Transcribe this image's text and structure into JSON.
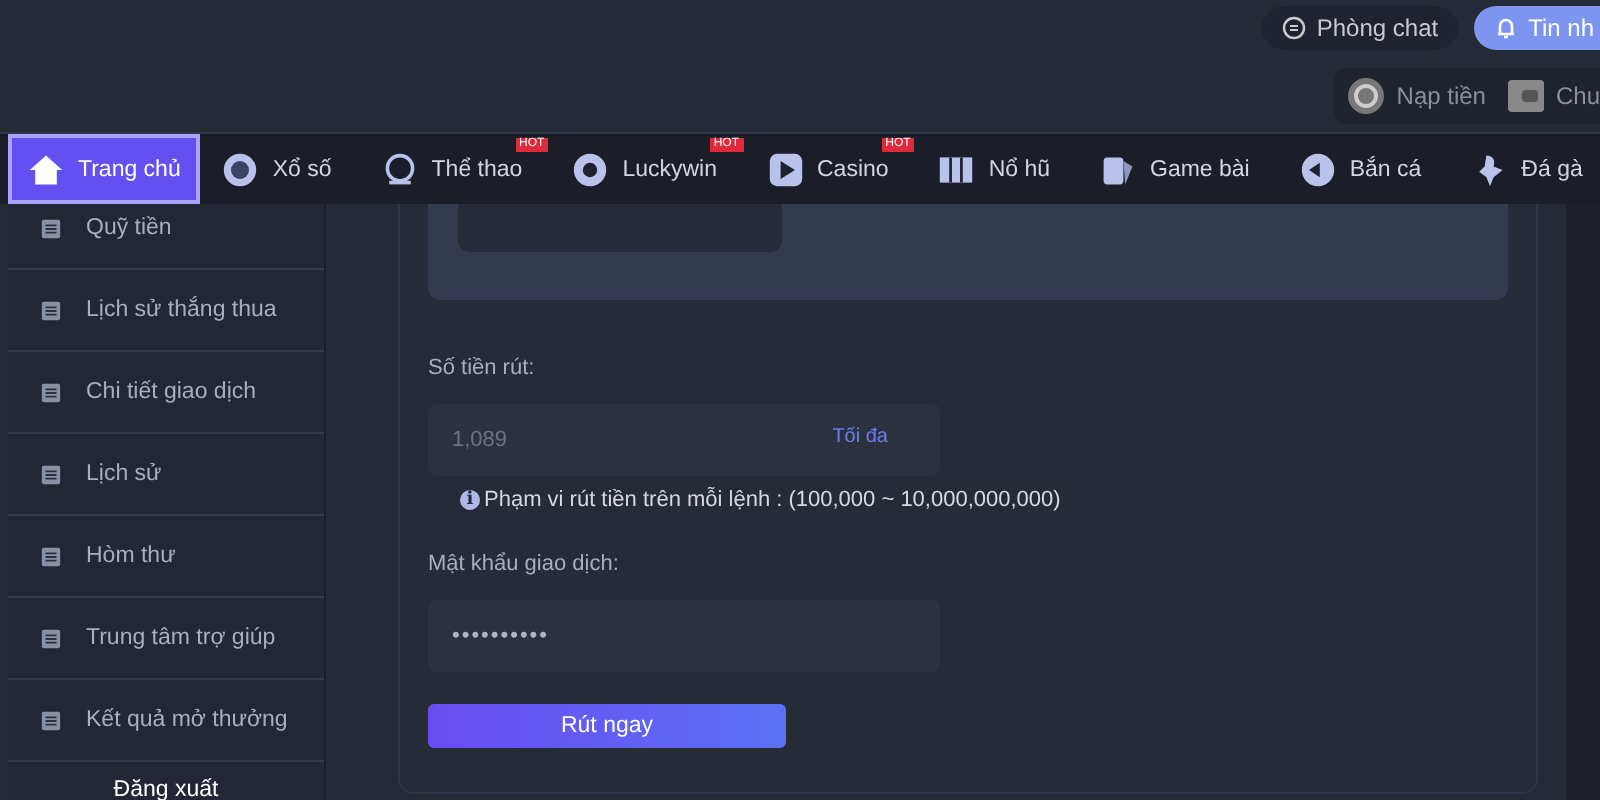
{
  "header": {
    "chat_button": "Phòng chat",
    "messages_button": "Tin nh",
    "deposit_button": "Nạp tiền",
    "transfer_button": "Chu"
  },
  "nav": [
    {
      "label": "Trang chủ",
      "selected": true
    },
    {
      "label": "Xổ số",
      "selected": false
    },
    {
      "label": "Thể thao",
      "selected": false,
      "badge": "HOT"
    },
    {
      "label": "Luckywin",
      "selected": false,
      "badge": "HOT"
    },
    {
      "label": "Casino",
      "selected": false,
      "badge": "HOT"
    },
    {
      "label": "Nổ hũ",
      "selected": false
    },
    {
      "label": "Game bài",
      "selected": false
    },
    {
      "label": "Bắn cá",
      "selected": false
    },
    {
      "label": "Đá gà",
      "selected": false
    }
  ],
  "sidebar": {
    "items": [
      "Quỹ tiền",
      "Lịch sử thắng thua",
      "Chi tiết giao dịch",
      "Lịch sử",
      "Hòm thư",
      "Trung tâm trợ giúp",
      "Kết quả mở thưởng"
    ],
    "logout": "Đăng xuất"
  },
  "form": {
    "amount_label": "Số tiền rút:",
    "amount_value": "1,089",
    "max_link": "Tối đa",
    "info_icon": "i",
    "range_note": "Phạm vi rút tiền trên mỗi lệnh : (100,000 ~ 10,000,000,000)",
    "password_label": "Mật khẩu giao dịch:",
    "password_value": "••••••••••",
    "submit": "Rút ngay"
  }
}
